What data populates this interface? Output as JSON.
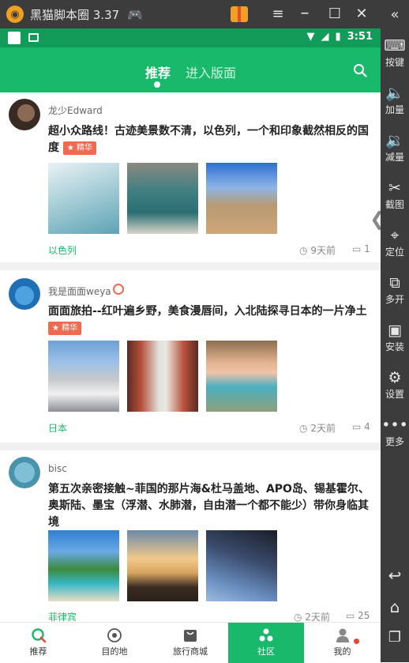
{
  "emulator": {
    "title": "黑猫脚本圈 3.37",
    "side_buttons": [
      {
        "label": "按键",
        "icon": "keyboard-icon"
      },
      {
        "label": "加量",
        "icon": "volume-up-icon"
      },
      {
        "label": "减量",
        "icon": "volume-down-icon"
      },
      {
        "label": "截图",
        "icon": "scissors-icon"
      },
      {
        "label": "定位",
        "icon": "location-icon"
      },
      {
        "label": "多开",
        "icon": "multi-open-icon"
      },
      {
        "label": "安装",
        "icon": "apk-icon"
      },
      {
        "label": "设置",
        "icon": "gear-icon"
      },
      {
        "label": "更多",
        "icon": "more-icon"
      }
    ]
  },
  "status_bar": {
    "time": "3:51"
  },
  "appbar": {
    "tabs": [
      "推荐",
      "进入版面"
    ],
    "active_tab": "推荐"
  },
  "posts": [
    {
      "user": "龙少Edward",
      "title": "超小众路线！古迹美景数不清，以色列，一个和印象截然相反的国度",
      "badge": "精华",
      "tag": "以色列",
      "time": "9天前",
      "comments": "1"
    },
    {
      "user": "我是面面weya",
      "title": "面面旅拍--红叶遍乡野，美食漫唇间，入北陆探寻日本的一片净土",
      "badge": "精华",
      "tag": "日本",
      "time": "2天前",
      "comments": "4"
    },
    {
      "user": "bisc",
      "title": "第五次亲密接触~菲国的那片海&杜马盖地、APO岛、锡基霍尔、奥斯陆、墨宝（浮潜、水肺潜，自由潜一个都不能少）带你身临其境",
      "tag": "菲律宾",
      "time": "2天前",
      "comments": "25"
    }
  ],
  "bottom_nav": [
    {
      "label": "推荐",
      "icon": "recommend-icon"
    },
    {
      "label": "目的地",
      "icon": "destination-icon"
    },
    {
      "label": "旅行商城",
      "icon": "shop-icon"
    },
    {
      "label": "社区",
      "icon": "community-icon"
    },
    {
      "label": "我的",
      "icon": "profile-icon"
    }
  ],
  "bottom_nav_active": "社区",
  "colors": {
    "accent": "#18b96b",
    "status_bar": "#129b59",
    "badge": "#f16a50",
    "emulator_chrome": "#3c3c3c"
  }
}
